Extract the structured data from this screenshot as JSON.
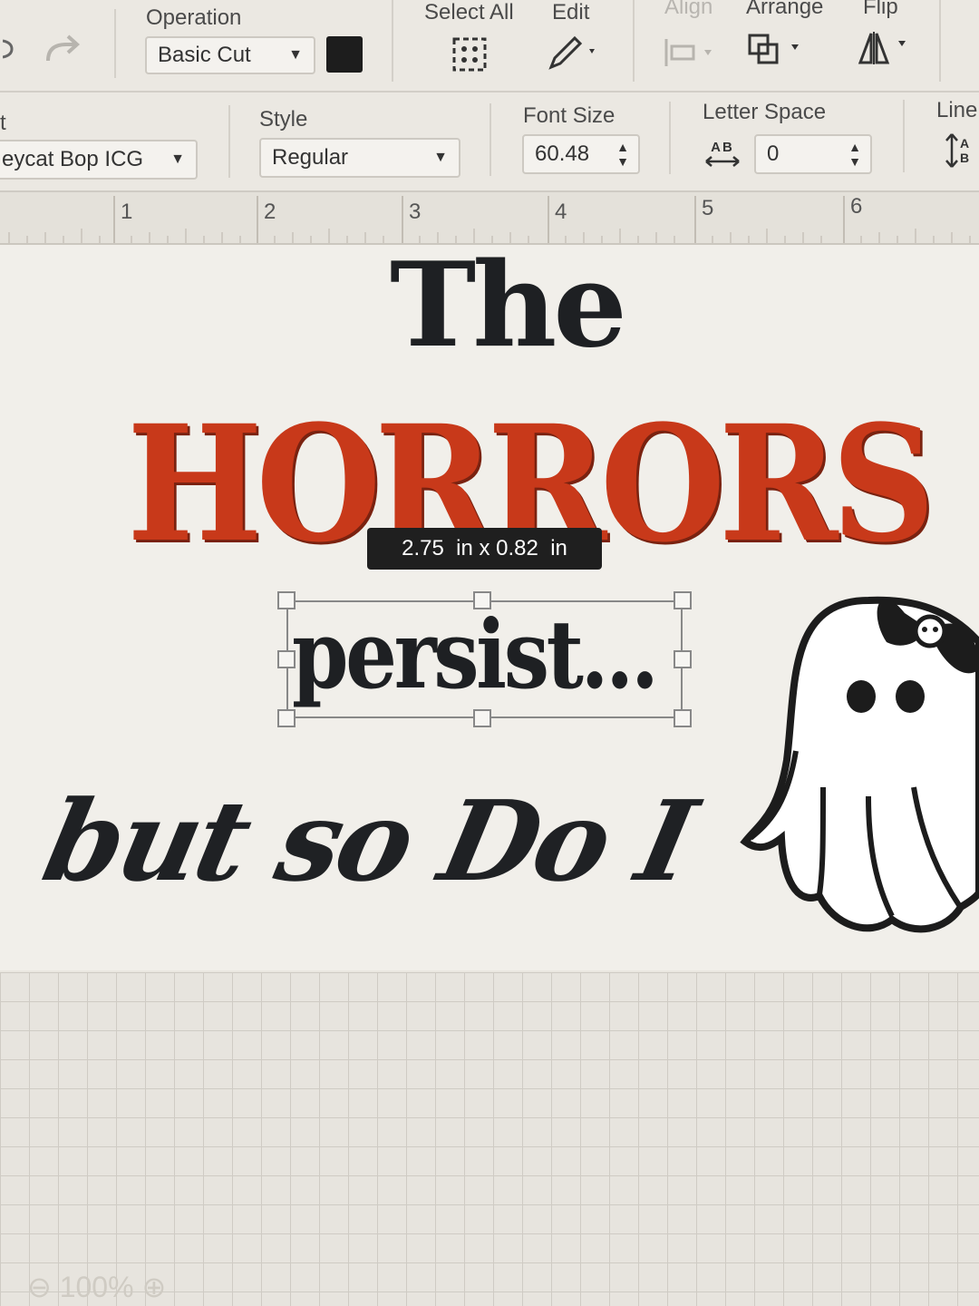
{
  "toolbar": {
    "operation_label": "Operation",
    "operation_value": "Basic Cut",
    "operation_color": "#1d1d1d",
    "select_all_label": "Select All",
    "edit_label": "Edit",
    "align_label": "Align",
    "arrange_label": "Arrange",
    "flip_label": "Flip"
  },
  "text_toolbar": {
    "font_label": "t",
    "font_value": "eycat Bop ICG",
    "style_label": "Style",
    "style_value": "Regular",
    "font_size_label": "Font Size",
    "font_size_value": "60.48",
    "letter_space_label": "Letter Space",
    "letter_space_value": "0",
    "letter_space_icon_text": "AB",
    "line_label": "Line",
    "line_icon_text_a": "A",
    "line_icon_text_b": "B"
  },
  "ruler": {
    "ticks": [
      "1",
      "2",
      "3",
      "4",
      "5",
      "6"
    ]
  },
  "canvas": {
    "line1": "The",
    "line2": "HORRORS",
    "line3": "persist...",
    "line4": "but so Do I",
    "dimension_tooltip": "2.75  in x 0.82  in",
    "accent_color": "#c8391a",
    "ink_color": "#1e2023"
  },
  "footer": {
    "zoom_value": "100%"
  }
}
